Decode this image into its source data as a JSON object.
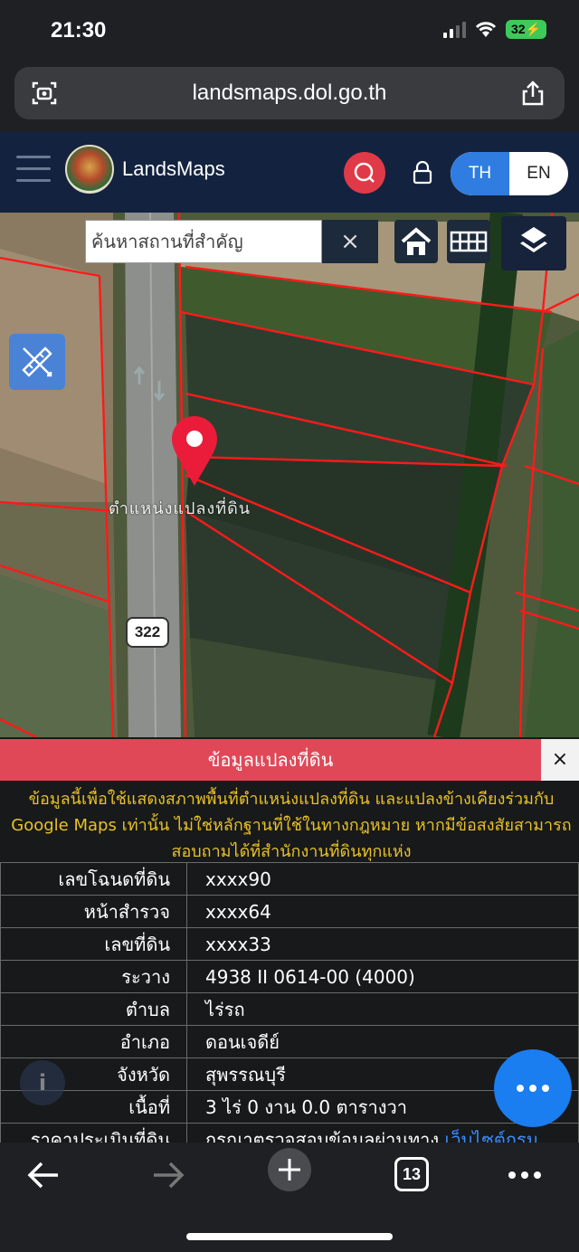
{
  "status": {
    "time": "21:30",
    "battery": "32"
  },
  "browser": {
    "url": "landsmaps.dol.go.th",
    "tab_count": "13"
  },
  "header": {
    "brand": "LandsMaps",
    "lang_th": "TH",
    "lang_en": "EN",
    "active_lang": "TH"
  },
  "map": {
    "search_placeholder": "ค้นหาสถานที่สำคัญ",
    "clear_label": "×",
    "parcel_label": "ตำแหน่งแปลงที่ดิน",
    "road_number": "322"
  },
  "panel": {
    "title": "ข้อมูลแปลงที่ดิน",
    "close_label": "×",
    "note": "ข้อมูลนี้เพื่อใช้แสดงสภาพพื้นที่ตำแหน่งแปลงที่ดิน และแปลงข้างเคียงร่วมกับ Google Maps เท่านั้น ไม่ใช่หลักฐานที่ใช้ในทางกฎหมาย หากมีข้อสงสัยสามารถสอบถามได้ที่สำนักงานที่ดินทุกแห่ง",
    "rows": [
      {
        "key": "เลขโฉนดที่ดิน",
        "value": "xxxx90"
      },
      {
        "key": "หน้าสำรวจ",
        "value": "xxxx64"
      },
      {
        "key": "เลขที่ดิน",
        "value": "xxxx33"
      },
      {
        "key": "ระวาง",
        "value": "4938 II 0614-00 (4000)"
      },
      {
        "key": "ตำบล",
        "value": "ไร่รถ"
      },
      {
        "key": "อำเภอ",
        "value": "ดอนเจดีย์"
      },
      {
        "key": "จังหวัด",
        "value": "สุพรรณบุรี"
      },
      {
        "key": "เนื้อที่",
        "value": "3 ไร่ 0 งาน 0.0 ตารางวา"
      },
      {
        "key": "ราคาประเมินที่ดิน",
        "value": "กรุณาตรวจสอบข้อมูลผ่านทาง ",
        "link": "เว็บไซต์กรม"
      }
    ]
  }
}
